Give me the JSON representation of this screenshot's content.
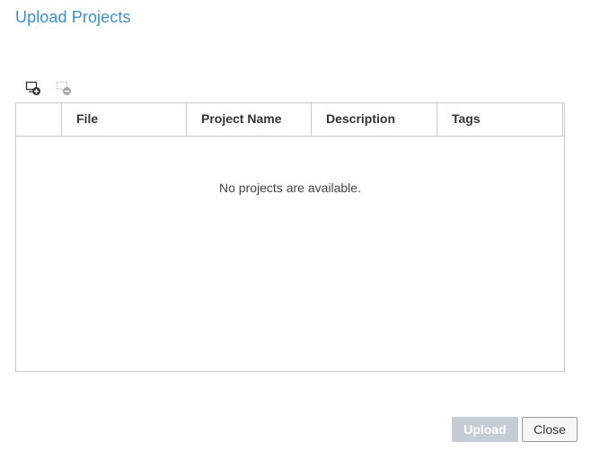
{
  "dialog": {
    "title": "Upload Projects"
  },
  "toolbar": {
    "add_icon": "add-project-icon",
    "remove_icon": "remove-project-icon",
    "remove_disabled": true
  },
  "table": {
    "columns": [
      "File",
      "Project Name",
      "Description",
      "Tags"
    ],
    "rows": [],
    "empty_message": "No projects are available."
  },
  "footer": {
    "upload_label": "Upload",
    "upload_disabled": true,
    "close_label": "Close"
  },
  "colors": {
    "title": "#3d8fd1",
    "border": "#c9c9c9",
    "disabled_button": "#c6ccd4"
  }
}
